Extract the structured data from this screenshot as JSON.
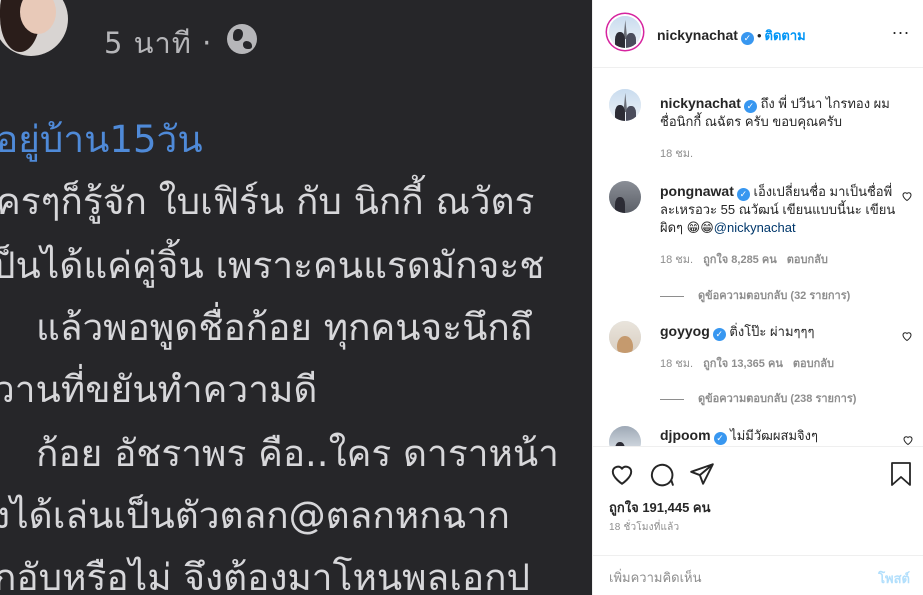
{
  "photo": {
    "time_text": "5 นาที ·",
    "lines": [
      "อยู่บ้าน15วัน",
      "ครๆก็รู้จัก ใบเฟิร์น กับ นิกกี้ ณวัตร",
      "ป็นได้แค่คู่จิ้น เพราะคนแรดมักจะช",
      "แล้วพอพูดชื่อก้อย ทุกคนจะนึกถึ",
      "วานที่ขยันทำความดี",
      "ก้อย อัชราพร คือ..ใคร ดาราหน้า",
      "งได้เล่นเป็นตัวตลก@ตลกหกฉาก",
      "กอับหรือไม่ จึงต้องมาโหนพลเอกป"
    ]
  },
  "header": {
    "username": "nickynachat",
    "separator": "•",
    "follow_label": "ติดตาม",
    "menu_label": "..."
  },
  "caption": {
    "username": "nickynachat",
    "text": "ถึง พี่ ปวีนา ไกรทอง ผมชื่อนิกกี้ ณฉัตร ครับ ขอบคุณครับ",
    "time": "18 ชม."
  },
  "comments": [
    {
      "username": "pongnawat",
      "text": "เอ็งเปลี่ยนชื่อ มาเป็นชื่อพี่ละเหรอวะ 55 ณวัฒน์ เขียนแบบนี้นะ เขียนผิดๆ 😁😁",
      "mention": "@nickynachat",
      "time": "18 ชม.",
      "likes": "ถูกใจ 8,285 คน",
      "reply": "ตอบกลับ",
      "view_replies": "ดูข้อความตอบกลับ (32 รายการ)"
    },
    {
      "username": "goyyog",
      "text": "ติ่งโป๊ะ ผ่ามๆๆๆ",
      "time": "18 ชม.",
      "likes": "ถูกใจ 13,365 คน",
      "reply": "ตอบกลับ",
      "view_replies": "ดูข้อความตอบกลับ (238 รายการ)"
    },
    {
      "username": "djpoom",
      "text": "ไม่มีวัฒผสมจิงๆ"
    }
  ],
  "footer": {
    "likes": "ถูกใจ 191,445 คน",
    "ago": "18 ชั่วโมงที่แล้ว",
    "comment_placeholder": "เพิ่มความคิดเห็น",
    "post_label": "โพสต์"
  },
  "colors": {
    "accent": "#0095f6",
    "verified": "#3897f0",
    "muted": "#8e8e8e",
    "photo_bg": "#262629",
    "photo_blue_text": "#4f8ad8"
  }
}
